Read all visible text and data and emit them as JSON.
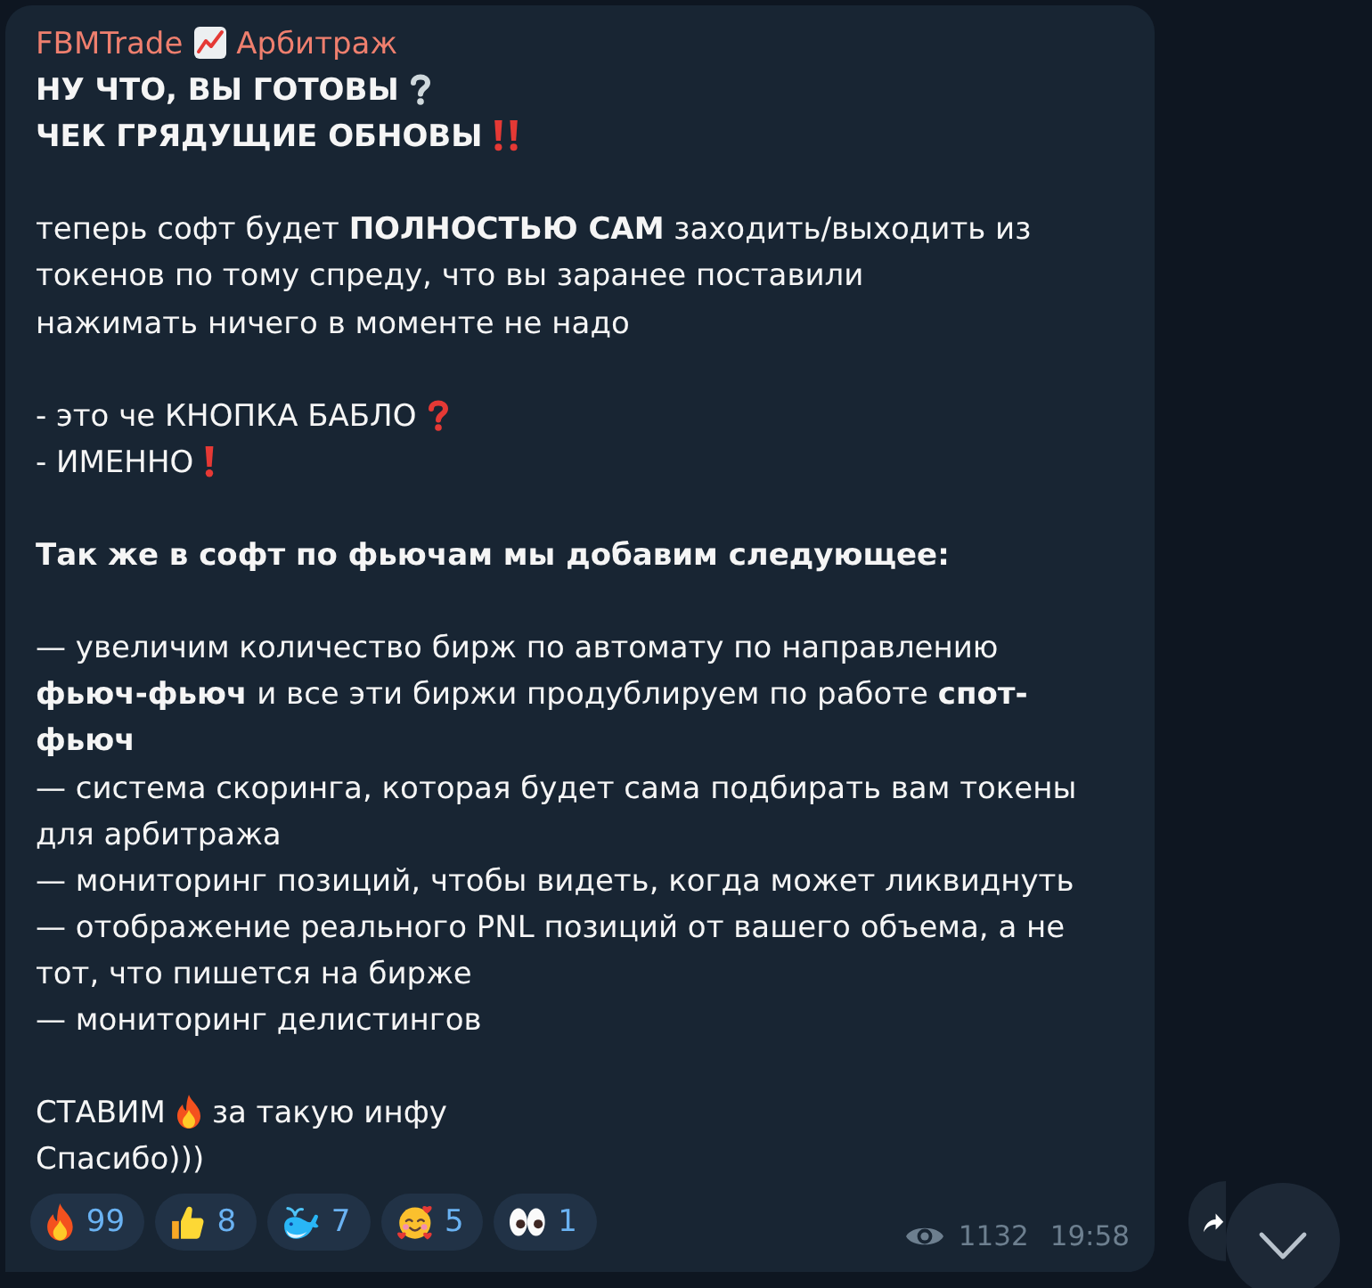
{
  "message": {
    "sender": [
      {
        "kind": "text",
        "text": "FBMTrade"
      },
      {
        "kind": "chart"
      },
      {
        "kind": "text",
        "text": "Арбитраж"
      }
    ],
    "paragraphs": [
      {
        "lines": [
          {
            "bold": true,
            "parts": [
              {
                "kind": "text",
                "text": "НУ ЧТО, ВЫ ГОТОВЫ"
              },
              {
                "kind": "question"
              }
            ]
          },
          {
            "bold": true,
            "parts": [
              {
                "kind": "text",
                "text": "ЧЕК ГРЯДУЩИЕ ОБНОВЫ"
              },
              {
                "kind": "doubleexclamation"
              }
            ]
          }
        ]
      },
      {
        "lines": [
          {
            "bold": false,
            "parts": [
              {
                "kind": "text",
                "text": "теперь софт будет **ПОЛНОСТЬЮ САМ** заходить/выходить из"
              }
            ]
          },
          {
            "bold": false,
            "parts": [
              {
                "kind": "text",
                "text": "токенов по тому спреду, что вы заранее поставили"
              }
            ]
          },
          {
            "bold": false,
            "parts": [
              {
                "kind": "text",
                "text": "нажимать ничего в моменте не надо"
              }
            ]
          }
        ]
      },
      {
        "lines": [
          {
            "bold": false,
            "parts": [
              {
                "kind": "text",
                "text": "- это че КНОПКА БАБЛО"
              },
              {
                "kind": "redquestion"
              }
            ]
          },
          {
            "bold": false,
            "parts": [
              {
                "kind": "text",
                "text": "- ИМЕННО"
              },
              {
                "kind": "exclamation"
              }
            ]
          }
        ]
      },
      {
        "lines": [
          {
            "bold": true,
            "parts": [
              {
                "kind": "text",
                "text": "Так же в софт по фьючам мы добавим следующее:"
              }
            ]
          }
        ]
      },
      {
        "lines": [
          {
            "bold": false,
            "parts": [
              {
                "kind": "text",
                "text": "— увеличим количество бирж по автомату по направлению"
              }
            ]
          },
          {
            "bold": false,
            "parts": [
              {
                "kind": "text",
                "text": "**фьюч-фьюч** и все эти биржи продублируем по работе **спот-**"
              }
            ]
          },
          {
            "bold": true,
            "parts": [
              {
                "kind": "text",
                "text": "фьюч"
              }
            ]
          },
          {
            "bold": false,
            "parts": [
              {
                "kind": "text",
                "text": "— система скоринга, которая будет сама подбирать вам токены"
              }
            ]
          },
          {
            "bold": false,
            "parts": [
              {
                "kind": "text",
                "text": "для арбитража"
              }
            ]
          },
          {
            "bold": false,
            "parts": [
              {
                "kind": "text",
                "text": "— мониторинг позиций, чтобы видеть, когда может ликвиднуть"
              }
            ]
          },
          {
            "bold": false,
            "parts": [
              {
                "kind": "text",
                "text": "— отображение реального PNL позиций от вашего объема, а не"
              }
            ]
          },
          {
            "bold": false,
            "parts": [
              {
                "kind": "text",
                "text": "тот, что пишется на бирже"
              }
            ]
          },
          {
            "bold": false,
            "parts": [
              {
                "kind": "text",
                "text": "— мониторинг делистингов"
              }
            ]
          }
        ]
      },
      {
        "lines": [
          {
            "bold": false,
            "parts": [
              {
                "kind": "text",
                "text": "СТАВИМ"
              },
              {
                "kind": "fire"
              },
              {
                "kind": "text",
                "text": "за такую инфу"
              }
            ]
          },
          {
            "bold": false,
            "parts": [
              {
                "kind": "text",
                "text": "Спасибо)))"
              }
            ]
          }
        ]
      }
    ],
    "reactions": [
      {
        "kind": "fire",
        "count": "99",
        "selected": false
      },
      {
        "kind": "thumbsup",
        "count": "8",
        "selected": false
      },
      {
        "kind": "whale",
        "count": "7",
        "selected": false
      },
      {
        "kind": "hearts",
        "count": "5",
        "selected": false
      },
      {
        "kind": "eyes",
        "count": "1",
        "selected": false
      }
    ],
    "views": "1132",
    "time": "19:58"
  }
}
